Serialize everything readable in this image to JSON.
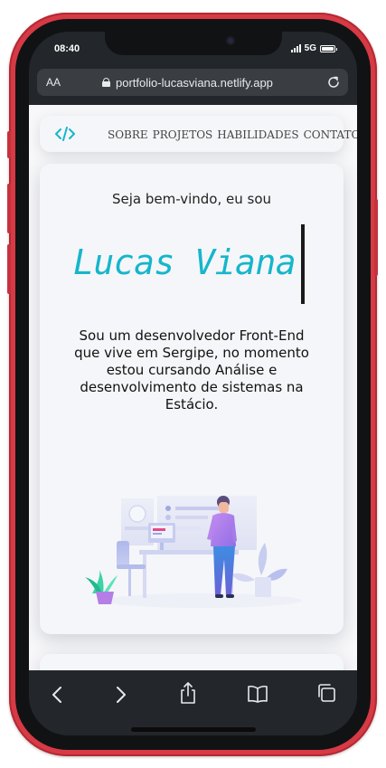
{
  "status_bar": {
    "time": "08:40",
    "network": "5G"
  },
  "browser": {
    "text_size_button": "AA",
    "url": "portfolio-lucasviana.netlify.app"
  },
  "site": {
    "nav_items": [
      "SOBRE",
      "PROJETOS",
      "HABILIDADES",
      "CONTATO"
    ],
    "greeting": "Seja bem-vindo, eu sou",
    "name": "Lucas Viana",
    "bio": "Sou um desenvolvedor Front-End que vive em Sergipe, no momento estou cursando Análise e desenvolvimento de sistemas na Estácio.",
    "accent_color": "#15b6cb"
  },
  "toolbar": {
    "icons": [
      "back-icon",
      "forward-icon",
      "share-icon",
      "bookmarks-icon",
      "tabs-icon"
    ]
  }
}
